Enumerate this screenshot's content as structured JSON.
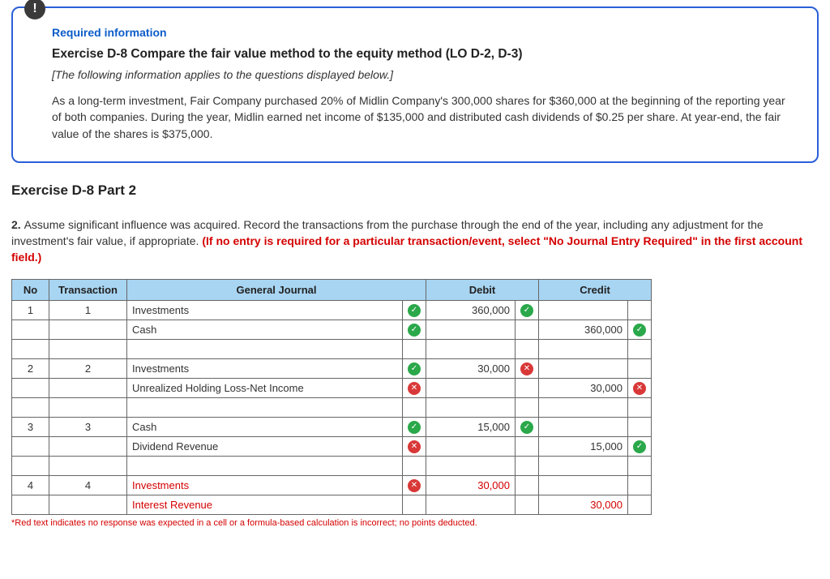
{
  "info": {
    "badge": "!",
    "required_label": "Required information",
    "title": "Exercise D-8 Compare the fair value method to the equity method (LO D-2, D-3)",
    "subtitle": "[The following information applies to the questions displayed below.]",
    "body": "As a long-term investment, Fair Company purchased 20% of Midlin Company's 300,000 shares for $360,000 at the beginning of the reporting year of both companies. During the year, Midlin earned net income of $135,000 and distributed cash dividends of $0.25 per share. At year-end, the fair value of the shares is $375,000."
  },
  "part_heading": "Exercise D-8 Part 2",
  "instruction": {
    "prefix": "2. ",
    "text": "Assume significant influence was acquired. Record the transactions from the purchase through the end of the year, including any adjustment for the investment's fair value, if appropriate. ",
    "red": "(If no entry is required for a particular transaction/event, select \"No Journal Entry Required\" in the first account field.)"
  },
  "journal": {
    "headers": {
      "no": "No",
      "transaction": "Transaction",
      "general": "General Journal",
      "debit": "Debit",
      "credit": "Credit"
    },
    "rows": [
      {
        "no": "1",
        "trans": "1",
        "account": "Investments",
        "indent": false,
        "status": "ok",
        "debit": "360,000",
        "debit_status": "ok",
        "credit": "",
        "credit_status": ""
      },
      {
        "no": "",
        "trans": "",
        "account": "Cash",
        "indent": true,
        "status": "ok",
        "debit": "",
        "debit_status": "",
        "credit": "360,000",
        "credit_status": "ok"
      },
      {
        "spacer": true
      },
      {
        "no": "2",
        "trans": "2",
        "account": "Investments",
        "indent": false,
        "status": "ok",
        "debit": "30,000",
        "debit_status": "bad",
        "credit": "",
        "credit_status": ""
      },
      {
        "no": "",
        "trans": "",
        "account": "Unrealized Holding Loss-Net Income",
        "indent": true,
        "status": "bad",
        "debit": "",
        "debit_status": "",
        "credit": "30,000",
        "credit_status": "bad"
      },
      {
        "spacer": true
      },
      {
        "no": "3",
        "trans": "3",
        "account": "Cash",
        "indent": false,
        "status": "ok",
        "debit": "15,000",
        "debit_status": "ok",
        "credit": "",
        "credit_status": ""
      },
      {
        "no": "",
        "trans": "",
        "account": "Dividend Revenue",
        "indent": true,
        "status": "bad",
        "debit": "",
        "debit_status": "",
        "credit": "15,000",
        "credit_status": "ok"
      },
      {
        "spacer": true
      },
      {
        "no": "4",
        "trans": "4",
        "account": "Investments",
        "indent": false,
        "red": true,
        "status": "bad",
        "debit": "30,000",
        "debit_status": "",
        "debit_red": true,
        "credit": "",
        "credit_status": ""
      },
      {
        "no": "",
        "trans": "",
        "account": "Interest Revenue",
        "indent": true,
        "red": true,
        "status": "",
        "debit": "",
        "debit_status": "",
        "credit": "30,000",
        "credit_status": "",
        "credit_red": true
      }
    ]
  },
  "footnote": "*Red text indicates no response was expected in a cell or a formula-based calculation is incorrect; no points deducted."
}
